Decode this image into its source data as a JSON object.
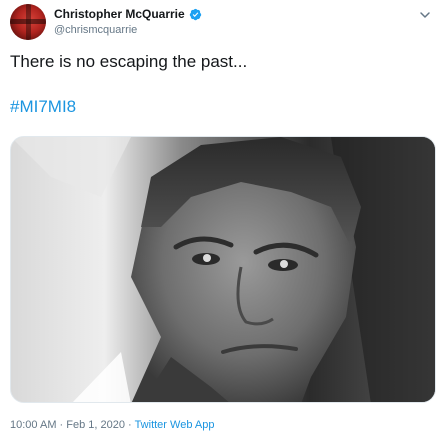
{
  "tweet": {
    "author": {
      "display_name": "Christopher McQuarrie",
      "handle": "@chrismcquarrie",
      "verified": true
    },
    "text": "There is no escaping the past...",
    "hashtag": "#MI7MI8",
    "media": {
      "type": "photo",
      "description_icon": "photo-icon"
    },
    "meta": {
      "time": "10:00 AM",
      "separator": " · ",
      "date": "Feb 1, 2020",
      "source": "Twitter Web App"
    }
  },
  "colors": {
    "link": "#1b95e0",
    "secondary_text": "#657786",
    "primary_text": "#14171a",
    "verified_badge": "#1da1f2"
  },
  "icons": {
    "verified": "verified-badge-icon",
    "menu": "chevron-down-icon"
  }
}
